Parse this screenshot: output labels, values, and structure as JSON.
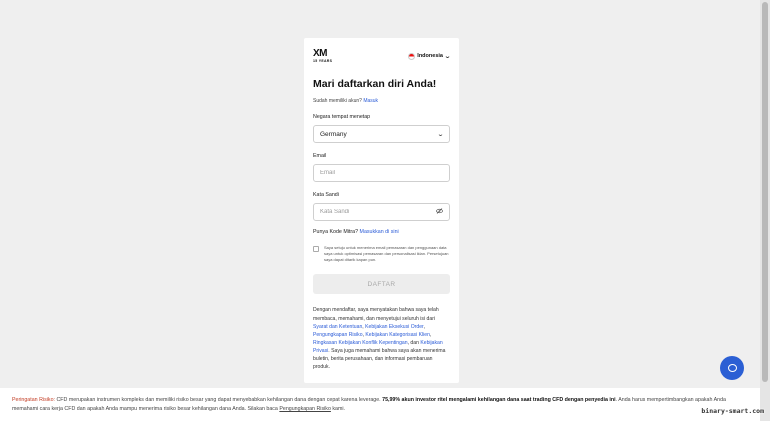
{
  "header": {
    "logo_text": "XM",
    "logo_sub": "15 YEARS",
    "language": "Indonesia"
  },
  "form": {
    "title": "Mari daftarkan diri Anda!",
    "have_account": "Sudah memiliki akun?",
    "login_link": "Masuk",
    "country_label": "Negara tempat menetap",
    "country_value": "Germany",
    "email_label": "Email",
    "email_placeholder": "Email",
    "password_label": "Kata Sandi",
    "password_placeholder": "Kata Sandi",
    "partner_question": "Punya Kode Mitra?",
    "partner_link": "Masukkan di sini",
    "consent_text": "Saya setuju untuk menerima email pemasaran dan penggunaan data saya untuk optimisasi pemasaran dan personalisasi iklan. Persetujuan saya dapat ditarik kapan pun.",
    "submit_label": "DAFTAR"
  },
  "terms": {
    "t1": "Dengan mendaftar, saya menyatakan bahwa saya telah membaca, memahami, dan menyetujui seluruh isi dari ",
    "l1": "Syarat dan Ketentuan",
    "s1": ", ",
    "l2": "Kebijakan Eksekusi Order",
    "s2": ", ",
    "l3": "Pengungkapan Risiko",
    "s3": ", ",
    "l4": "Kebijakan Kategorisasi Klien",
    "s4": ", ",
    "l5": "Ringkasan Kebijakan Konflik Kepentingan",
    "s5": ", dan ",
    "l6": "Kebijakan Privasi",
    "t2": ". Saya juga memahami bahwa saya akan menerima buletin, berita perusahaan, dan informasi pembaruan produk."
  },
  "footer": {
    "risk_label": "Peringatan Risiko:",
    "risk_text1": " CFD merupakan instrumen kompleks dan memiliki risiko besar yang dapat menyebabkan kehilangan dana dengan cepat karena leverage. ",
    "risk_bold": "75,99% akun investor ritel mengalami kehilangan dana saat trading CFD dengan penyedia ini",
    "risk_text2": ". Anda harus mempertimbangkan apakah Anda memahami cara kerja CFD dan apakah Anda mampu menerima risiko besar kehilangan dana Anda. Silakan baca ",
    "risk_link": "Pengungkapan Risiko",
    "risk_text3": " kami."
  },
  "watermark": "binary-smart.com"
}
